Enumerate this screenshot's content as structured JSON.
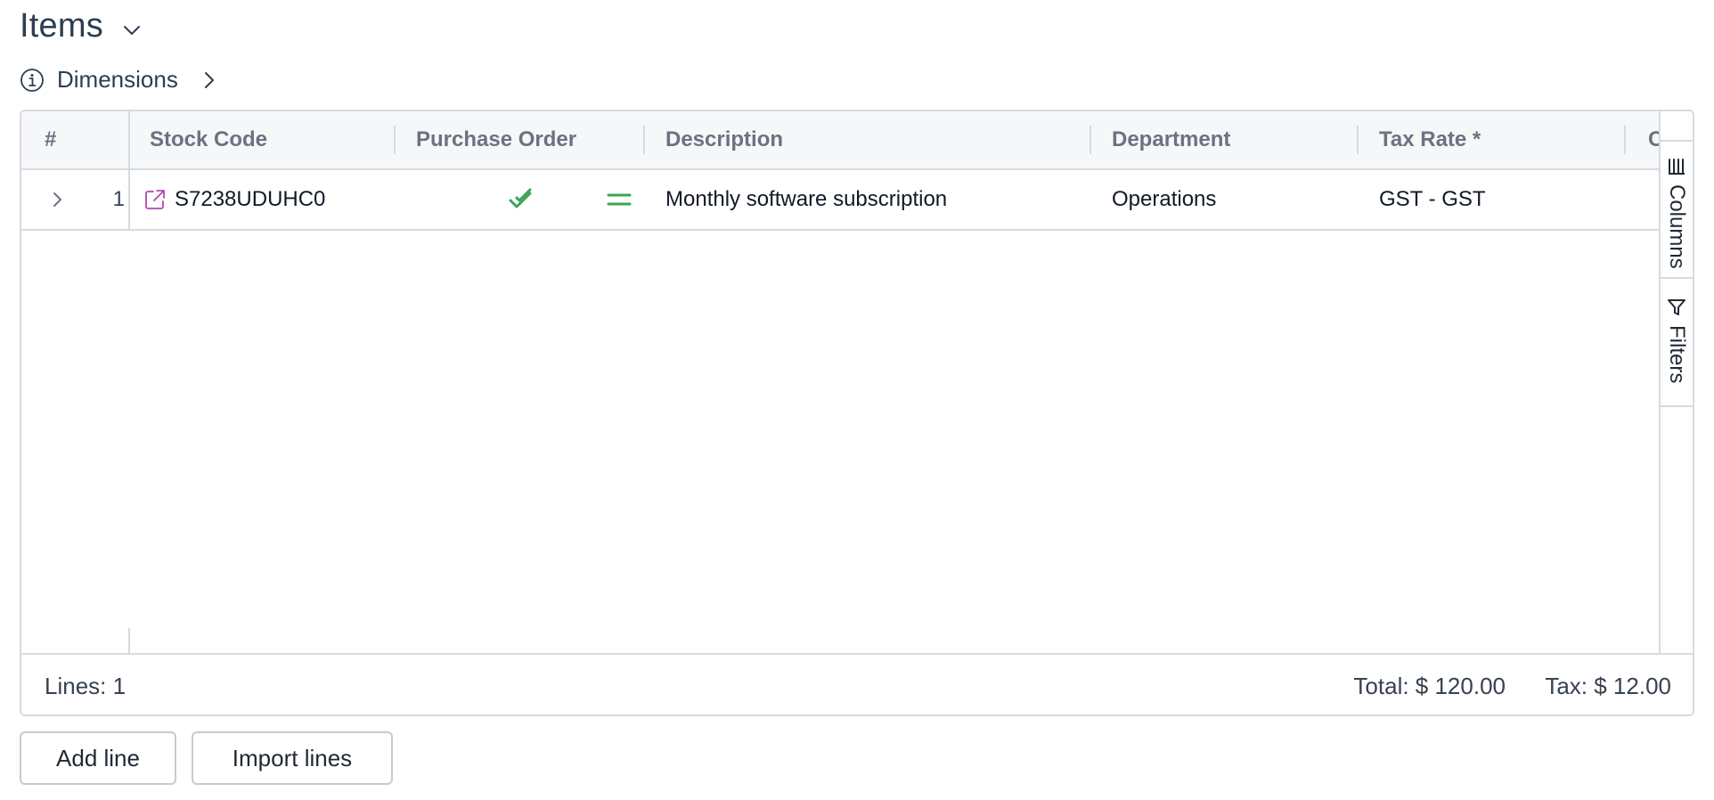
{
  "header": {
    "title": "Items"
  },
  "dimensions": {
    "label": "Dimensions"
  },
  "grid": {
    "columns": [
      {
        "key": "num",
        "label": "#"
      },
      {
        "key": "stock_code",
        "label": "Stock Code"
      },
      {
        "key": "purchase_order",
        "label": "Purchase Order"
      },
      {
        "key": "description",
        "label": "Description"
      },
      {
        "key": "department",
        "label": "Department"
      },
      {
        "key": "tax_rate",
        "label": "Tax Rate *"
      },
      {
        "key": "next",
        "label": "C"
      }
    ],
    "rows": [
      {
        "num": "1",
        "stock_code": "S7238UDUHC0",
        "description": "Monthly software subscription",
        "department": "Operations",
        "tax_rate": "GST - GST"
      }
    ]
  },
  "side_panel": {
    "columns_label": "Columns",
    "filters_label": "Filters"
  },
  "footer": {
    "lines": "Lines: 1",
    "total": "Total: $ 120.00",
    "tax": "Tax: $ 12.00"
  },
  "actions": {
    "add_line": "Add line",
    "import_lines": "Import lines"
  },
  "colors": {
    "check_green": "#3aa655",
    "link_purple": "#b347b3",
    "border": "#d6dbe1",
    "header_bg": "#f6f7f9"
  },
  "icons": {
    "title_toggle": "chevron-down-icon",
    "dimensions_info": "info-icon",
    "dimensions_expand": "chevron-right-icon",
    "row_expand": "chevron-right-icon",
    "stock_link": "external-link-icon",
    "po_status": "double-check-icon",
    "po_match": "equals-icon",
    "columns_tool": "columns-icon",
    "filters_tool": "filter-icon"
  }
}
